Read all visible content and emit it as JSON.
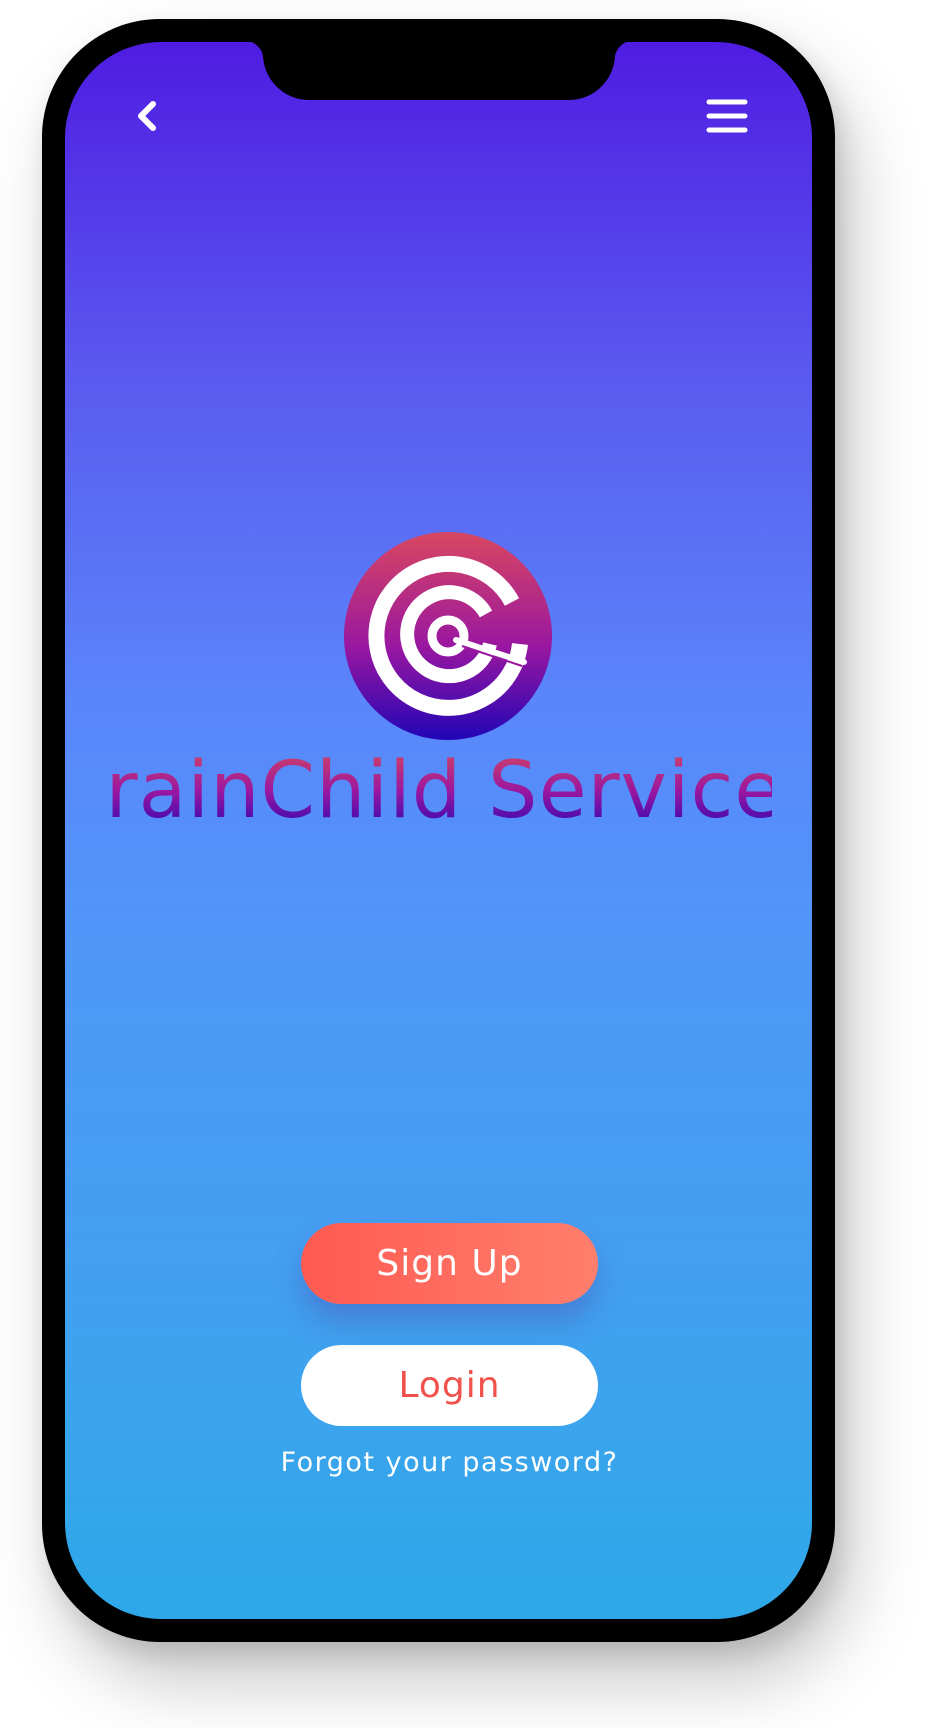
{
  "header": {
    "back_icon": "chevron-left-icon",
    "menu_icon": "hamburger-menu-icon"
  },
  "brand": {
    "name": "BrainChild Services",
    "logo_icon": "brainchild-target-logo",
    "colors": {
      "logo_top": "#d8475f",
      "logo_mid": "#9a17a0",
      "logo_bottom": "#2105b6"
    }
  },
  "actions": {
    "signup_label": "Sign Up",
    "login_label": "Login",
    "forgot_label": "Forgot your password?"
  },
  "theme": {
    "gradient_top": "#4f1ce2",
    "gradient_bottom": "#2ea8e8",
    "accent": "#ff5a52"
  }
}
